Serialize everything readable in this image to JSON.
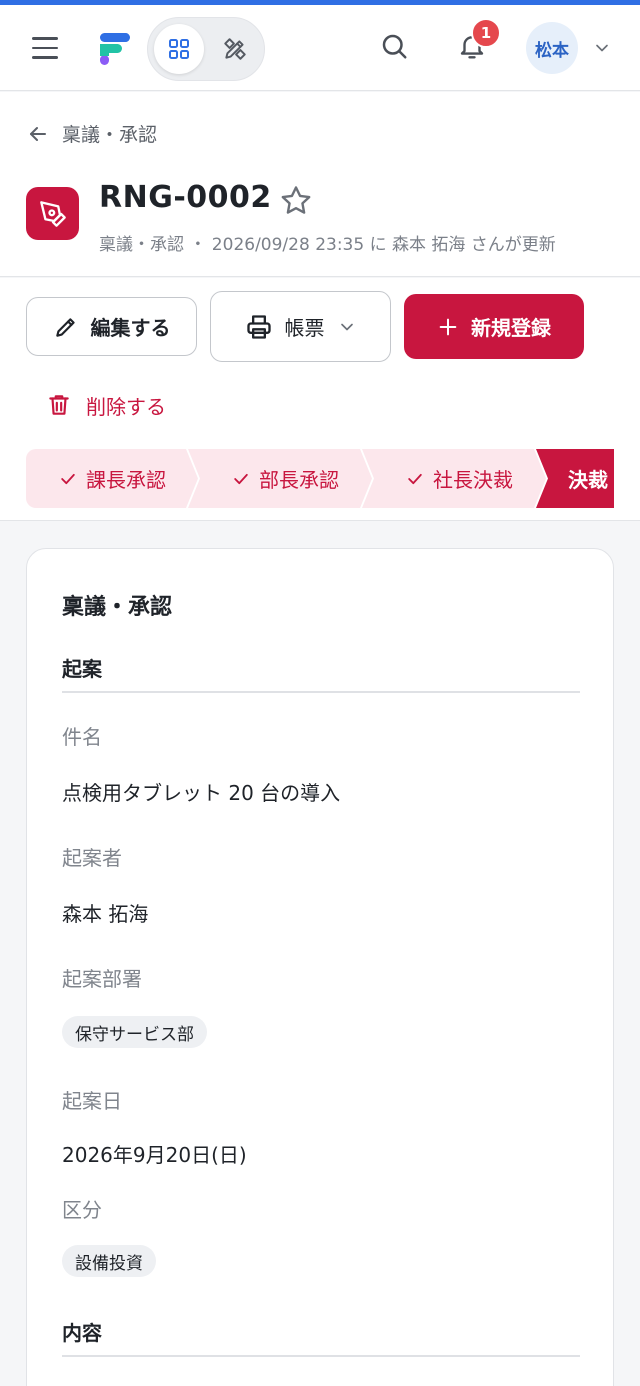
{
  "header": {
    "notification_count": "1",
    "user_name": "松本"
  },
  "breadcrumb": {
    "label": "稟議・承認"
  },
  "record": {
    "title": "RNG-0002",
    "meta": "稟議・承認 ・ 2026/09/28 23:35 に 森本 拓海 さんが更新"
  },
  "actions": {
    "edit_label": "編集する",
    "print_label": "帳票",
    "new_label": "新規登録",
    "delete_label": "削除する"
  },
  "steps": [
    {
      "label": "課長承認",
      "done": true
    },
    {
      "label": "部長承認",
      "done": true
    },
    {
      "label": "社長決裁",
      "done": true
    },
    {
      "label": "決裁",
      "done": false
    }
  ],
  "card": {
    "title": "稟議・承認",
    "section1": "起案",
    "fields": {
      "subject_label": "件名",
      "subject_value": "点検用タブレット 20 台の導入",
      "drafter_label": "起案者",
      "drafter_value": "森本 拓海",
      "dept_label": "起案部署",
      "dept_value": "保守サービス部",
      "date_label": "起案日",
      "date_value": "2026年9月20日(日)",
      "category_label": "区分",
      "category_value": "設備投資"
    },
    "section2": "内容"
  },
  "colors": {
    "brand": "#c8163f",
    "accent": "#2f6fe4",
    "step_bg": "#fce7ec"
  }
}
